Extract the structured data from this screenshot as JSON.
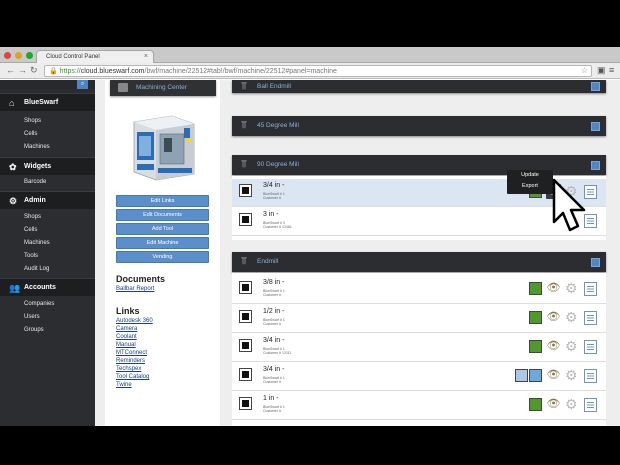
{
  "browser": {
    "tab_title": "Cloud Control Panel",
    "url_scheme": "https://",
    "url_host": "cloud.blueswarf.com",
    "url_path": "/bwf/machine/22512#tab!/bwf/machine/22512#panel=machine"
  },
  "sidebar": {
    "brand": "BlueSwarf",
    "sections": [
      {
        "title": "BlueSwarf",
        "items": [
          "Shops",
          "Cells",
          "Machines"
        ]
      },
      {
        "title": "Widgets",
        "items": [
          "Barcode"
        ]
      },
      {
        "title": "Admin",
        "items": [
          "Shops",
          "Cells",
          "Machines",
          "Tools",
          "Audit Log"
        ]
      },
      {
        "title": "Accounts",
        "items": [
          "Companies",
          "Users",
          "Groups"
        ]
      }
    ]
  },
  "machine_card": {
    "title": "Machining Center",
    "buttons": [
      "Edit Links",
      "Edit Documents",
      "Add Tool",
      "Edit Machine",
      "Vending"
    ],
    "documents_heading": "Documents",
    "documents": [
      "Ballbar Report"
    ],
    "links_heading": "Links",
    "links": [
      "Autodesk 360",
      "Camera",
      "Coolant",
      "Manual",
      "MTConnect",
      "Reminders",
      "Techspex",
      "Tool Catalog",
      "Twine"
    ]
  },
  "panels": {
    "ball_endmill": {
      "title": "Ball Endmill"
    },
    "mill_45": {
      "title": "45 Degree Mill"
    },
    "mill_90": {
      "title": "90 Degree Mill",
      "rows": [
        {
          "name": "3/4 in -",
          "serial": "BlueSwarf # 1",
          "customer": "Customer #"
        },
        {
          "name": "3 in -",
          "serial": "BlueSwarf # 3",
          "customer": "Customer #  12461"
        }
      ]
    },
    "endmill": {
      "title": "Endmill",
      "rows": [
        {
          "name": "3/8 in -",
          "serial": "BlueSwarf # 1",
          "customer": "Customer #"
        },
        {
          "name": "1/2 in -",
          "serial": "BlueSwarf # 1",
          "customer": "Customer #"
        },
        {
          "name": "3/4 in -",
          "serial": "BlueSwarf # 1",
          "customer": "Customer #  12111"
        },
        {
          "name": "3/4 in -",
          "serial": "BlueSwarf # 1",
          "customer": "Customer #"
        },
        {
          "name": "1 in -",
          "serial": "BlueSwarf # 1",
          "customer": "Customer #"
        }
      ]
    }
  },
  "dropdown": {
    "items": [
      "Update",
      "Export"
    ]
  },
  "colors": {
    "accent": "#5b8fcc",
    "status_green": "#4f9a2a",
    "status_blue": "#6fa8dc"
  },
  "icons": [
    "search-icon",
    "home-icon",
    "widgets-icon",
    "admin-icon",
    "accounts-icon",
    "tool-icon",
    "eye-icon",
    "gear-icon",
    "document-icon"
  ]
}
